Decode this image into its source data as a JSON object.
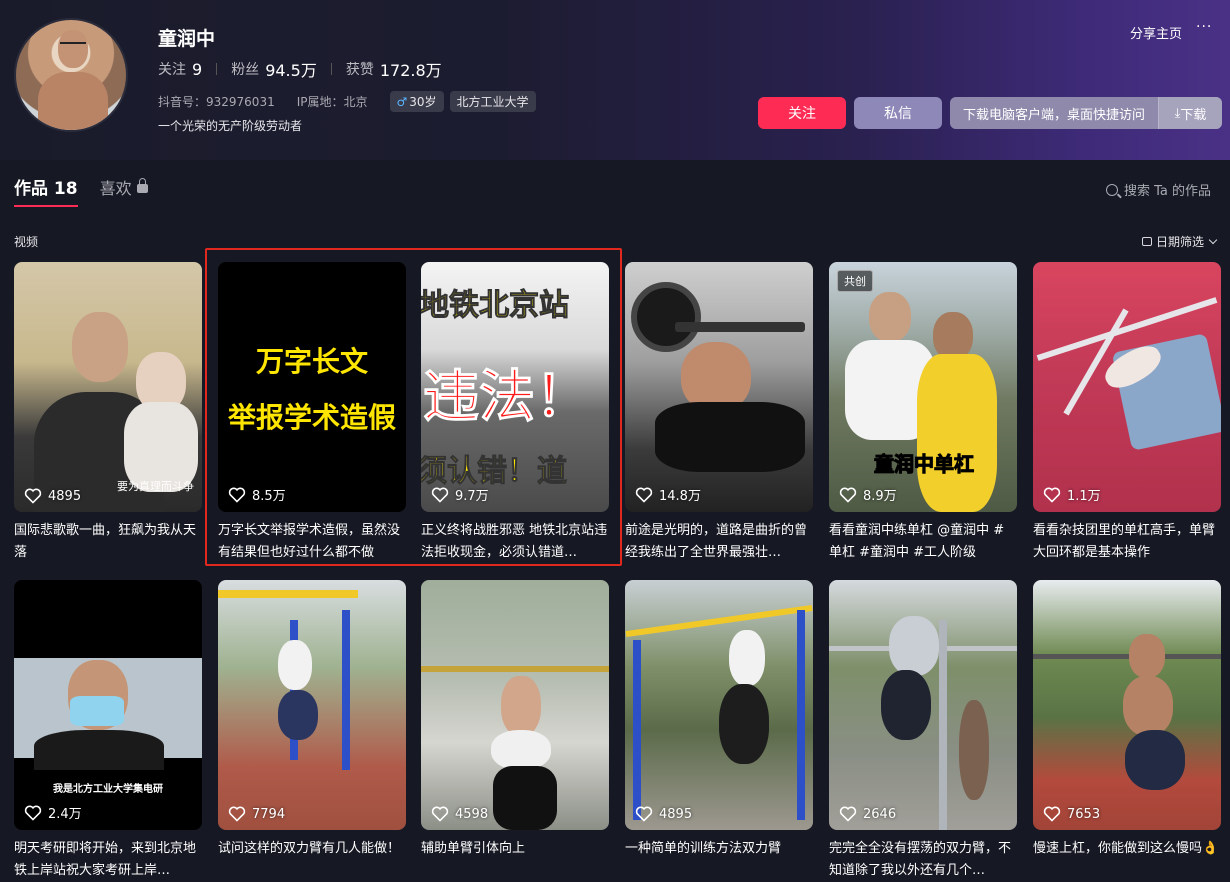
{
  "profile": {
    "name": "童润中",
    "following_label": "关注",
    "following": "9",
    "fans_label": "粉丝",
    "fans": "94.5万",
    "likes_label": "获赞",
    "likes": "172.8万",
    "douyin_id": "抖音号：932976031",
    "ip": "IP属地：北京",
    "age_tag": "30岁",
    "school_tag": "北方工业大学",
    "bio": "一个光荣的无产阶级劳动者"
  },
  "header": {
    "share_label": "分享主页",
    "more_label": "···",
    "follow_button": "关注",
    "message_button": "私信",
    "download_text": "下载电脑客户端，桌面快捷访问",
    "download_button": "下载"
  },
  "tabs": {
    "works": "作品 18",
    "likes": "喜欢"
  },
  "search": {
    "label": "搜索 Ta 的作品"
  },
  "section": {
    "label": "视频",
    "date_filter": "日期筛选"
  },
  "videos": [
    {
      "likes": "4895",
      "title": "国际悲歌歌一曲，狂飙为我从天落",
      "caption": "要为真理而斗争"
    },
    {
      "likes": "8.5万",
      "title": "万字长文举报学术造假，虽然没有结果但也好过什么都不做",
      "line1": "万字长文",
      "line2": "举报学术造假"
    },
    {
      "likes": "9.7万",
      "title": "正义终将战胜邪恶 地铁北京站违法拒收现金，必须认错道…",
      "line1": "地铁北京站",
      "line2": "违法！",
      "line3": "须认错！道"
    },
    {
      "likes": "14.8万",
      "title": "前途是光明的，道路是曲折的曾经我练出了全世界最强壮…"
    },
    {
      "likes": "8.9万",
      "title": "看看童润中练单杠 @童润中 #单杠 #童润中 #工人阶级",
      "badge": "共创",
      "caption": "童润中单杠"
    },
    {
      "likes": "1.1万",
      "title": "看看杂技团里的单杠高手，单臂大回环都是基本操作"
    },
    {
      "likes": "2.4万",
      "title": "明天考研即将开始，来到北京地铁上岸站祝大家考研上岸…",
      "caption": "我是北方工业大学集电研"
    },
    {
      "likes": "7794",
      "title": "试问这样的双力臂有几人能做！"
    },
    {
      "likes": "4598",
      "title": "辅助单臂引体向上"
    },
    {
      "likes": "4895",
      "title": "一种简单的训练方法双力臂"
    },
    {
      "likes": "2646",
      "title": "完完全全没有摆荡的双力臂，不知道除了我以外还有几个…"
    },
    {
      "likes": "7653",
      "title": "慢速上杠，你能做到这么慢吗👌"
    }
  ],
  "icons": [
    "heart-icon",
    "search-icon",
    "lock-icon",
    "calendar-icon",
    "male-icon",
    "download-icon"
  ]
}
